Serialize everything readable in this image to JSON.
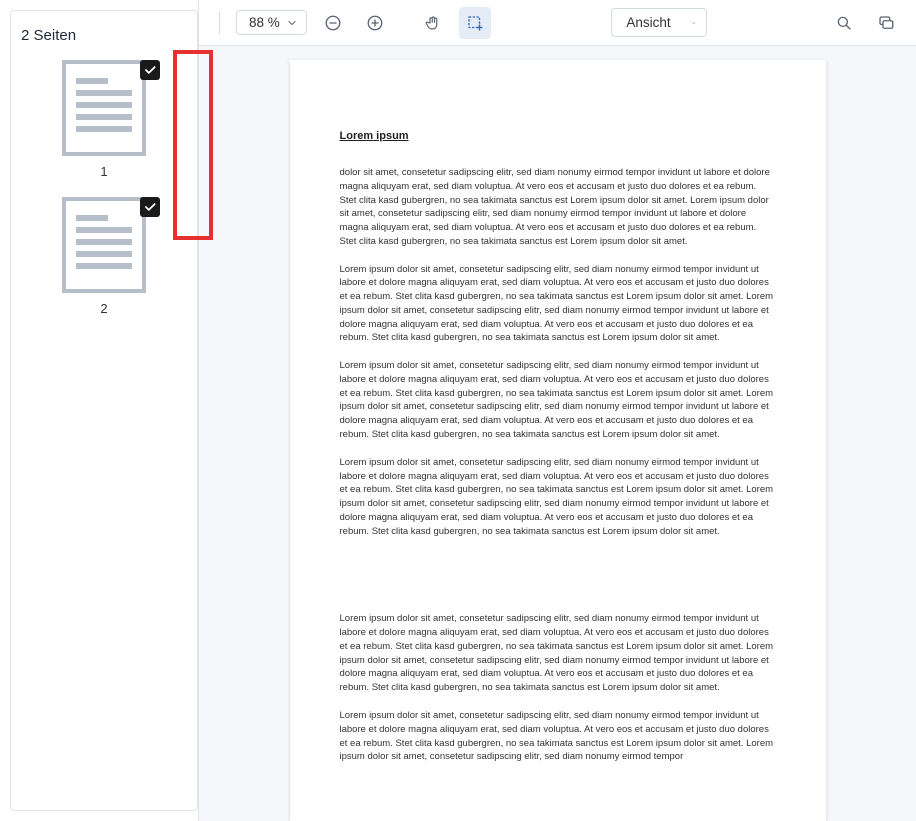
{
  "sidebar": {
    "title": "2 Seiten",
    "thumbs": [
      {
        "label": "1",
        "checked": true
      },
      {
        "label": "2",
        "checked": true
      }
    ]
  },
  "toolbar": {
    "zoom_label": "88 %",
    "view_label": "Ansicht"
  },
  "document": {
    "title": "Lorem ipsum",
    "paragraphs": [
      "dolor sit amet, consetetur sadipscing elitr, sed diam nonumy eirmod tempor invidunt ut labore et dolore magna aliquyam erat, sed diam voluptua. At vero eos et accusam et justo duo dolores et ea rebum. Stet clita kasd gubergren, no sea takimata sanctus est Lorem ipsum dolor sit amet. Lorem ipsum dolor sit amet, consetetur sadipscing elitr, sed diam nonumy eirmod tempor invidunt ut labore et dolore magna aliquyam erat, sed diam voluptua. At vero eos et accusam et justo duo dolores et ea rebum. Stet clita kasd gubergren, no sea takimata sanctus est Lorem ipsum dolor sit amet.",
      "Lorem ipsum dolor sit amet, consetetur sadipscing elitr, sed diam nonumy eirmod tempor invidunt ut labore et dolore magna aliquyam erat, sed diam voluptua. At vero eos et accusam et justo duo dolores et ea rebum. Stet clita kasd gubergren, no sea takimata sanctus est Lorem ipsum dolor sit amet. Lorem ipsum dolor sit amet, consetetur sadipscing elitr, sed diam nonumy eirmod tempor invidunt ut labore et dolore magna aliquyam erat, sed diam voluptua. At vero eos et accusam et justo duo dolores et ea rebum. Stet clita kasd gubergren, no sea takimata sanctus est Lorem ipsum dolor sit amet.",
      "Lorem ipsum dolor sit amet, consetetur sadipscing elitr, sed diam nonumy eirmod tempor invidunt ut labore et dolore magna aliquyam erat, sed diam voluptua. At vero eos et accusam et justo duo dolores et ea rebum. Stet clita kasd gubergren, no sea takimata sanctus est Lorem ipsum dolor sit amet. Lorem ipsum dolor sit amet, consetetur sadipscing elitr, sed diam nonumy eirmod tempor invidunt ut labore et dolore magna aliquyam erat, sed diam voluptua. At vero eos et accusam et justo duo dolores et ea rebum. Stet clita kasd gubergren, no sea takimata sanctus est Lorem ipsum dolor sit amet.",
      "Lorem ipsum dolor sit amet, consetetur sadipscing elitr, sed diam nonumy eirmod tempor invidunt ut labore et dolore magna aliquyam erat, sed diam voluptua. At vero eos et accusam et justo duo dolores et ea rebum. Stet clita kasd gubergren, no sea takimata sanctus est Lorem ipsum dolor sit amet. Lorem ipsum dolor sit amet, consetetur sadipscing elitr, sed diam nonumy eirmod tempor invidunt ut labore et dolore magna aliquyam erat, sed diam voluptua. At vero eos et accusam et justo duo dolores et ea rebum. Stet clita kasd gubergren, no sea takimata sanctus est Lorem ipsum dolor sit amet.",
      "Lorem ipsum dolor sit amet, consetetur sadipscing elitr, sed diam nonumy eirmod tempor invidunt ut labore et dolore magna aliquyam erat, sed diam voluptua. At vero eos et accusam et justo duo dolores et ea rebum. Stet clita kasd gubergren, no sea takimata sanctus est Lorem ipsum dolor sit amet. Lorem ipsum dolor sit amet, consetetur sadipscing elitr, sed diam nonumy eirmod tempor invidunt ut labore et dolore magna aliquyam erat, sed diam voluptua. At vero eos et accusam et justo duo dolores et ea rebum. Stet clita kasd gubergren, no sea takimata sanctus est Lorem ipsum dolor sit amet.",
      "Lorem ipsum dolor sit amet, consetetur sadipscing elitr, sed diam nonumy eirmod tempor invidunt ut labore et dolore magna aliquyam erat, sed diam voluptua. At vero eos et accusam et justo duo dolores et ea rebum. Stet clita kasd gubergren, no sea takimata sanctus est Lorem ipsum dolor sit amet. Lorem ipsum dolor sit amet, consetetur sadipscing elitr, sed diam nonumy eirmod tempor"
    ]
  }
}
